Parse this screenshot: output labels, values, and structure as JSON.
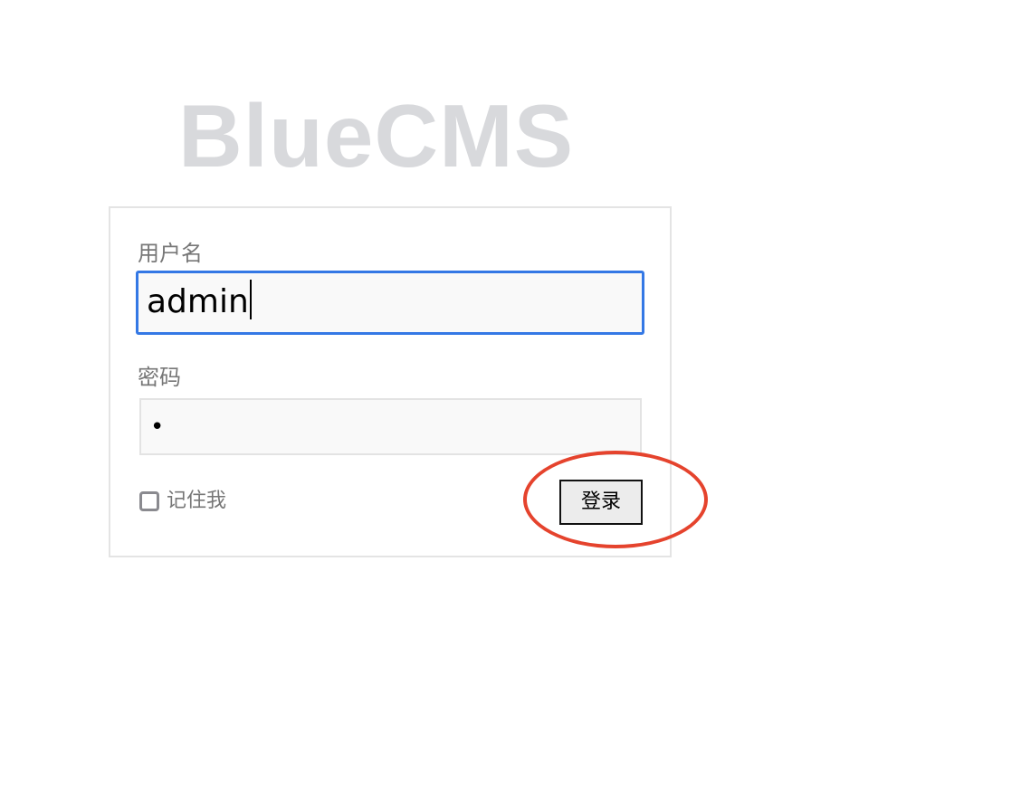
{
  "logo": {
    "text": "BlueCMS"
  },
  "form": {
    "username_label": "用户名",
    "username_value": "admin",
    "password_label": "密码",
    "password_value": "•",
    "remember_label": "记住我",
    "remember_checked": false,
    "login_label": "登录"
  },
  "colors": {
    "focus_border": "#3478e5",
    "highlight_annotation": "#e5432d",
    "logo": "#d8d9dc"
  }
}
